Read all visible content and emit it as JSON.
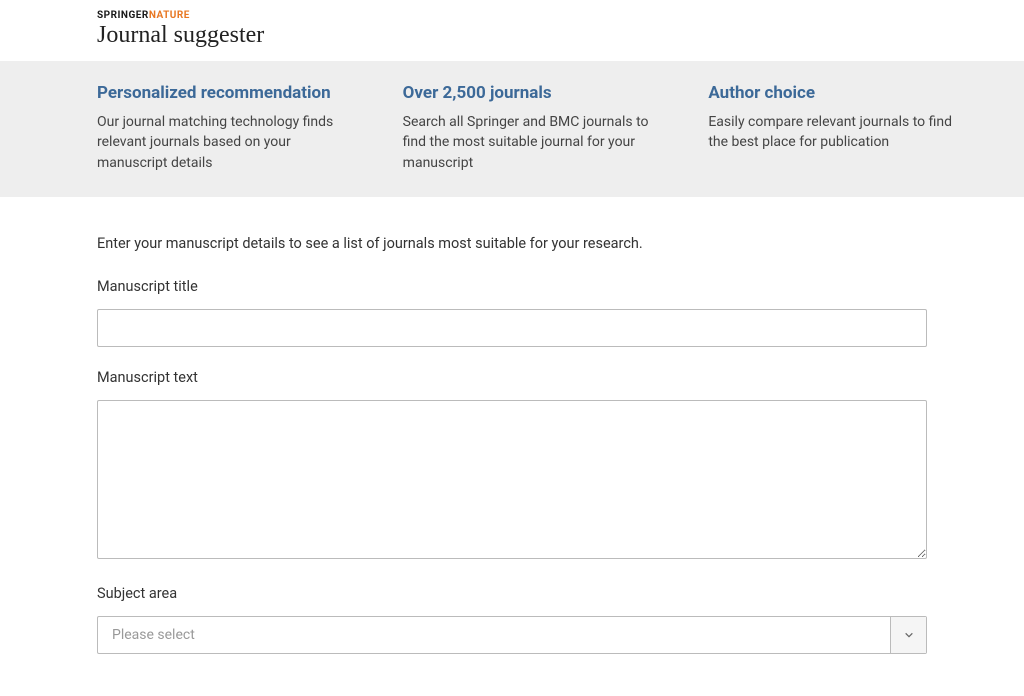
{
  "header": {
    "brand_part1": "SPRINGER",
    "brand_part2": "NATURE",
    "app_title": "Journal suggester"
  },
  "features": [
    {
      "title": "Personalized recommendation",
      "desc": "Our journal matching technology finds relevant journals based on your manuscript details"
    },
    {
      "title": "Over 2,500 journals",
      "desc": "Search all Springer and BMC journals to find the most suitable journal for your manuscript"
    },
    {
      "title": "Author choice",
      "desc": "Easily compare relevant journals to find the best place for publication"
    }
  ],
  "form": {
    "intro": "Enter your manuscript details to see a list of journals most suitable for your research.",
    "title_label": "Manuscript title",
    "title_value": "",
    "text_label": "Manuscript text",
    "text_value": "",
    "subject_label": "Subject area",
    "subject_selected": "Please select"
  }
}
